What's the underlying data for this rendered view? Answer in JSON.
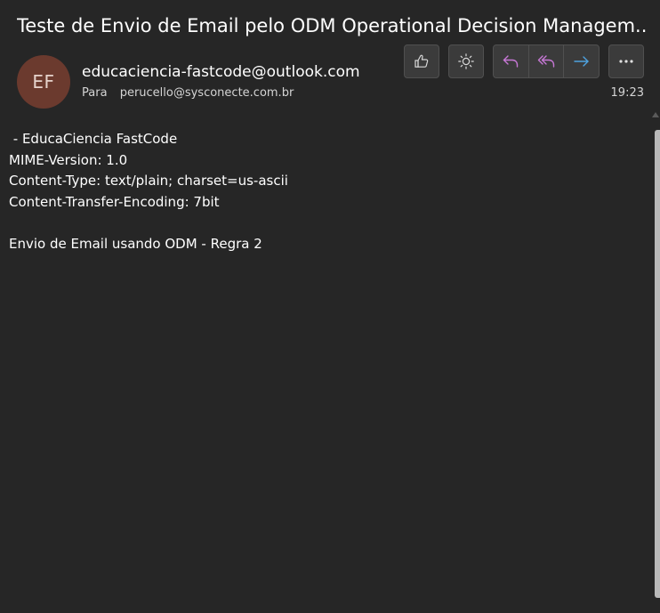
{
  "message": {
    "subject": "Teste de Envio de Email pelo ODM Operational Decision Managem...",
    "avatar_initials": "EF",
    "sender": "educaciencia-fastcode@outlook.com",
    "to_label": "Para",
    "to_address": "perucello@sysconecte.com.br",
    "time": "19:23"
  },
  "toolbar": {
    "like_icon": "thumbs-up-icon",
    "sun_icon": "sun-icon",
    "reply_icon": "reply-icon",
    "reply_all_icon": "reply-all-icon",
    "forward_icon": "forward-icon",
    "more_icon": "more-horizontal-icon"
  },
  "body_lines": [
    " - EducaCiencia FastCode",
    "MIME-Version: 1.0",
    "Content-Type: text/plain; charset=us-ascii",
    "Content-Transfer-Encoding: 7bit",
    "",
    "Envio de Email usando ODM - Regra 2"
  ],
  "colors": {
    "background": "#262626",
    "avatar_bg": "#6b3a2e",
    "reply_accent": "#c778d6",
    "forward_accent": "#4ea3e0"
  }
}
